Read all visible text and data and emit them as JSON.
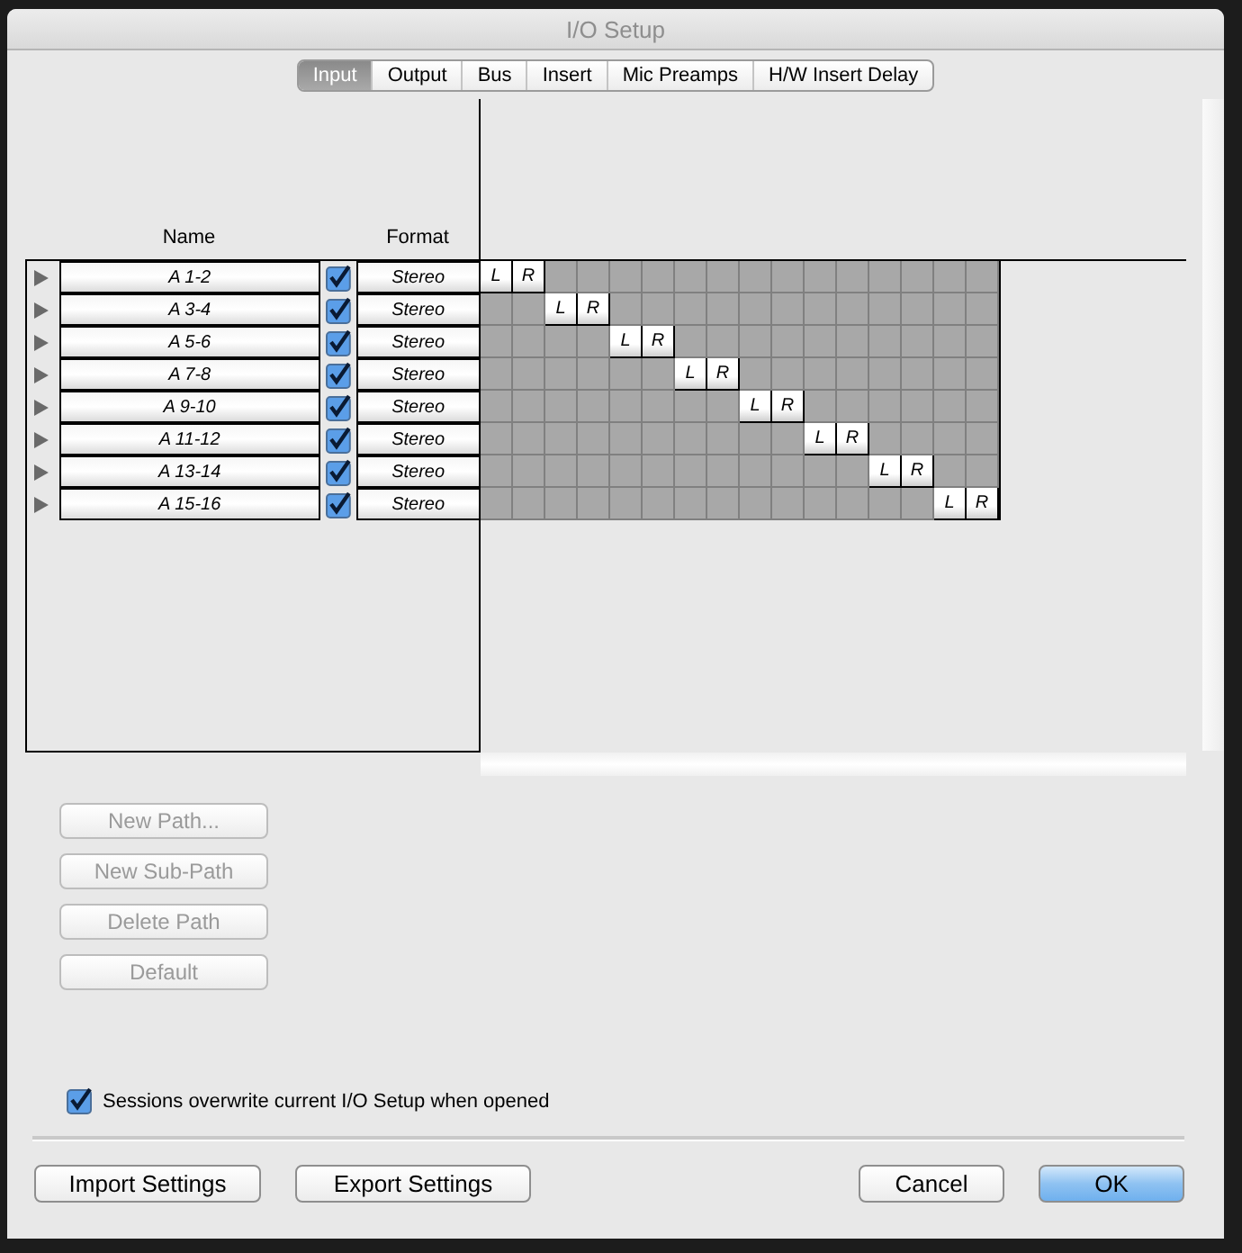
{
  "window": {
    "title": "I/O Setup"
  },
  "tabs": [
    {
      "label": "Input",
      "selected": true
    },
    {
      "label": "Output",
      "selected": false
    },
    {
      "label": "Bus",
      "selected": false
    },
    {
      "label": "Insert",
      "selected": false
    },
    {
      "label": "Mic Preamps",
      "selected": false
    },
    {
      "label": "H/W Insert Delay",
      "selected": false
    }
  ],
  "table": {
    "columns": [
      "Name",
      "Format"
    ],
    "rows": [
      {
        "name": "A 1-2",
        "checked": true,
        "format": "Stereo",
        "cells": [
          {
            "assigned": true,
            "label": "L"
          },
          {
            "assigned": true,
            "label": "R"
          },
          {
            "assigned": false
          },
          {
            "assigned": false
          },
          {
            "assigned": false
          },
          {
            "assigned": false
          },
          {
            "assigned": false
          },
          {
            "assigned": false
          },
          {
            "assigned": false
          },
          {
            "assigned": false
          },
          {
            "assigned": false
          },
          {
            "assigned": false
          },
          {
            "assigned": false
          },
          {
            "assigned": false
          },
          {
            "assigned": false
          },
          {
            "assigned": false
          }
        ]
      },
      {
        "name": "A 3-4",
        "checked": true,
        "format": "Stereo",
        "cells": [
          {
            "assigned": false
          },
          {
            "assigned": false
          },
          {
            "assigned": true,
            "label": "L"
          },
          {
            "assigned": true,
            "label": "R"
          },
          {
            "assigned": false
          },
          {
            "assigned": false
          },
          {
            "assigned": false
          },
          {
            "assigned": false
          },
          {
            "assigned": false
          },
          {
            "assigned": false
          },
          {
            "assigned": false
          },
          {
            "assigned": false
          },
          {
            "assigned": false
          },
          {
            "assigned": false
          },
          {
            "assigned": false
          },
          {
            "assigned": false
          }
        ]
      },
      {
        "name": "A 5-6",
        "checked": true,
        "format": "Stereo",
        "cells": [
          {
            "assigned": false
          },
          {
            "assigned": false
          },
          {
            "assigned": false
          },
          {
            "assigned": false
          },
          {
            "assigned": true,
            "label": "L"
          },
          {
            "assigned": true,
            "label": "R"
          },
          {
            "assigned": false
          },
          {
            "assigned": false
          },
          {
            "assigned": false
          },
          {
            "assigned": false
          },
          {
            "assigned": false
          },
          {
            "assigned": false
          },
          {
            "assigned": false
          },
          {
            "assigned": false
          },
          {
            "assigned": false
          },
          {
            "assigned": false
          }
        ]
      },
      {
        "name": "A 7-8",
        "checked": true,
        "format": "Stereo",
        "cells": [
          {
            "assigned": false
          },
          {
            "assigned": false
          },
          {
            "assigned": false
          },
          {
            "assigned": false
          },
          {
            "assigned": false
          },
          {
            "assigned": false
          },
          {
            "assigned": true,
            "label": "L"
          },
          {
            "assigned": true,
            "label": "R"
          },
          {
            "assigned": false
          },
          {
            "assigned": false
          },
          {
            "assigned": false
          },
          {
            "assigned": false
          },
          {
            "assigned": false
          },
          {
            "assigned": false
          },
          {
            "assigned": false
          },
          {
            "assigned": false
          }
        ]
      },
      {
        "name": "A 9-10",
        "checked": true,
        "format": "Stereo",
        "cells": [
          {
            "assigned": false
          },
          {
            "assigned": false
          },
          {
            "assigned": false
          },
          {
            "assigned": false
          },
          {
            "assigned": false
          },
          {
            "assigned": false
          },
          {
            "assigned": false
          },
          {
            "assigned": false
          },
          {
            "assigned": true,
            "label": "L"
          },
          {
            "assigned": true,
            "label": "R"
          },
          {
            "assigned": false
          },
          {
            "assigned": false
          },
          {
            "assigned": false
          },
          {
            "assigned": false
          },
          {
            "assigned": false
          },
          {
            "assigned": false
          }
        ]
      },
      {
        "name": "A 11-12",
        "checked": true,
        "format": "Stereo",
        "cells": [
          {
            "assigned": false
          },
          {
            "assigned": false
          },
          {
            "assigned": false
          },
          {
            "assigned": false
          },
          {
            "assigned": false
          },
          {
            "assigned": false
          },
          {
            "assigned": false
          },
          {
            "assigned": false
          },
          {
            "assigned": false
          },
          {
            "assigned": false
          },
          {
            "assigned": true,
            "label": "L"
          },
          {
            "assigned": true,
            "label": "R"
          },
          {
            "assigned": false
          },
          {
            "assigned": false
          },
          {
            "assigned": false
          },
          {
            "assigned": false
          }
        ]
      },
      {
        "name": "A 13-14",
        "checked": true,
        "format": "Stereo",
        "cells": [
          {
            "assigned": false
          },
          {
            "assigned": false
          },
          {
            "assigned": false
          },
          {
            "assigned": false
          },
          {
            "assigned": false
          },
          {
            "assigned": false
          },
          {
            "assigned": false
          },
          {
            "assigned": false
          },
          {
            "assigned": false
          },
          {
            "assigned": false
          },
          {
            "assigned": false
          },
          {
            "assigned": false
          },
          {
            "assigned": true,
            "label": "L"
          },
          {
            "assigned": true,
            "label": "R"
          },
          {
            "assigned": false
          },
          {
            "assigned": false
          }
        ]
      },
      {
        "name": "A 15-16",
        "checked": true,
        "format": "Stereo",
        "cells": [
          {
            "assigned": false
          },
          {
            "assigned": false
          },
          {
            "assigned": false
          },
          {
            "assigned": false
          },
          {
            "assigned": false
          },
          {
            "assigned": false
          },
          {
            "assigned": false
          },
          {
            "assigned": false
          },
          {
            "assigned": false
          },
          {
            "assigned": false
          },
          {
            "assigned": false
          },
          {
            "assigned": false
          },
          {
            "assigned": false
          },
          {
            "assigned": false
          },
          {
            "assigned": true,
            "label": "L"
          },
          {
            "assigned": true,
            "label": "R"
          }
        ]
      }
    ]
  },
  "path_buttons": [
    {
      "label": "New Path...",
      "disabled": true
    },
    {
      "label": "New Sub-Path",
      "disabled": true
    },
    {
      "label": "Delete Path",
      "disabled": true
    },
    {
      "label": "Default",
      "disabled": true
    }
  ],
  "overwrite_option": {
    "label": "Sessions overwrite current I/O Setup when opened",
    "checked": true
  },
  "footer_buttons": [
    {
      "label": "Import Settings",
      "kind": "plain"
    },
    {
      "label": "Export Settings",
      "kind": "plain"
    },
    {
      "label": "Cancel",
      "kind": "plain"
    },
    {
      "label": "OK",
      "kind": "default"
    }
  ]
}
